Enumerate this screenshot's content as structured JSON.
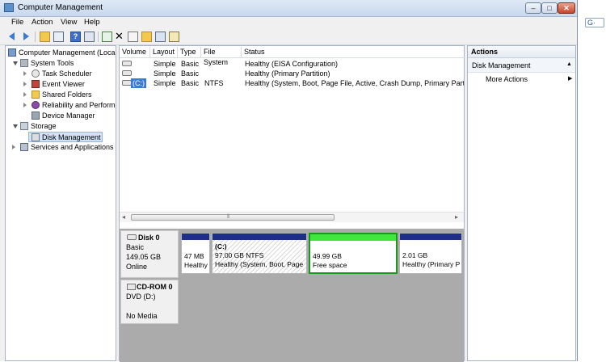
{
  "window": {
    "title": "Computer Management"
  },
  "menu": [
    "File",
    "Action",
    "View",
    "Help"
  ],
  "tree": {
    "root": "Computer Management (Local",
    "system_tools": "System Tools",
    "task_scheduler": "Task Scheduler",
    "event_viewer": "Event Viewer",
    "shared_folders": "Shared Folders",
    "reliability": "Reliability and Performa",
    "device_manager": "Device Manager",
    "storage": "Storage",
    "disk_management": "Disk Management",
    "services": "Services and Applications"
  },
  "volume_table": {
    "headers": [
      "Volume",
      "Layout",
      "Type",
      "File System",
      "Status"
    ],
    "rows": [
      {
        "volume": "",
        "layout": "Simple",
        "type": "Basic",
        "fs": "",
        "status": "Healthy (EISA Configuration)"
      },
      {
        "volume": "",
        "layout": "Simple",
        "type": "Basic",
        "fs": "",
        "status": "Healthy (Primary Partition)"
      },
      {
        "volume": "(C:)",
        "layout": "Simple",
        "type": "Basic",
        "fs": "NTFS",
        "status": "Healthy (System, Boot, Page File, Active, Crash Dump, Primary Partition)"
      }
    ]
  },
  "scroll": {
    "grip": "⦀"
  },
  "disks": {
    "disk0": {
      "name": "Disk 0",
      "type": "Basic",
      "size": "149.05 GB",
      "state": "Online"
    },
    "cdrom0": {
      "name": "CD-ROM 0",
      "type": "DVD (D:)",
      "media": "No Media"
    }
  },
  "partitions": [
    {
      "label": "",
      "size": "47 MB",
      "status": "Healthy"
    },
    {
      "label": "(C:)",
      "size": "97.00 GB NTFS",
      "status": "Healthy (System, Boot, Page"
    },
    {
      "label": "",
      "size": "49.99 GB",
      "status": "Free space"
    },
    {
      "label": "",
      "size": "2.01 GB",
      "status": "Healthy (Primary P"
    }
  ],
  "actions": {
    "title": "Actions",
    "section": "Disk Management",
    "more": "More Actions"
  },
  "sidebar": {
    "g_label": "G·"
  },
  "colors": {
    "primary_bar": "#1d2f87",
    "free_bar": "#3ee83e",
    "free_border": "#1a9a1a",
    "selection": "#cfe2f8"
  }
}
